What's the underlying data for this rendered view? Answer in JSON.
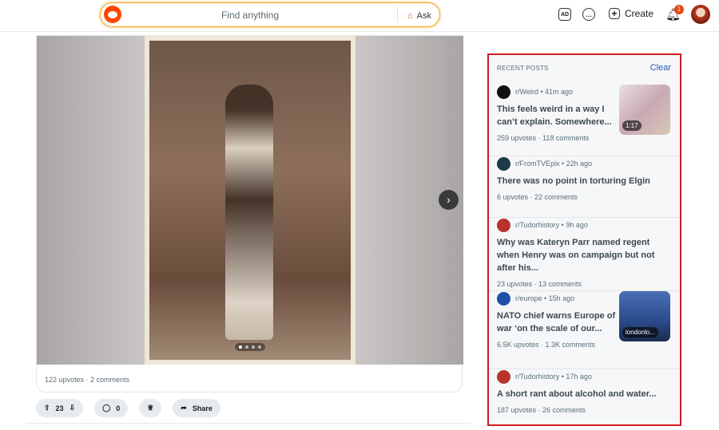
{
  "header": {
    "search_placeholder": "Find anything",
    "ask_label": "Ask",
    "ad_icon_text": "AD",
    "create_label": "Create",
    "notification_count": "1"
  },
  "post": {
    "stats": "122 upvotes · 2 comments",
    "vote_count": "23",
    "comment_count": "0",
    "share_label": "Share",
    "next_icon": "›"
  },
  "sidebar": {
    "heading": "RECENT POSTS",
    "clear_label": "Clear",
    "posts": [
      {
        "meta": "r/Weird • 41m ago",
        "title": "This feels weird in a way I can’t explain. Somewhere...",
        "stats": "259 upvotes · 118 comments",
        "thumb_label": "1:17",
        "icon_color": "#111111"
      },
      {
        "meta": "r/FromTVEpix • 22h ago",
        "title": "There was no point in torturing Elgin",
        "stats": "6 upvotes · 22 comments",
        "icon_color": "#1d3a4a"
      },
      {
        "meta": "r/Tudorhistory • 9h ago",
        "title": "Why was Kateryn Parr named regent when Henry was on campaign but not after his...",
        "stats": "23 upvotes · 13 comments",
        "icon_color": "#b8332a"
      },
      {
        "meta": "r/europe • 15h ago",
        "title": "NATO chief warns Europe of war ‘on the scale of our...",
        "stats": "6.5K upvotes · 1.3K comments",
        "thumb_label": "londonlo...",
        "icon_color": "#1f4fa8"
      },
      {
        "meta": "r/Tudorhistory • 17h ago",
        "title": "A short rant about alcohol and water...",
        "stats": "187 upvotes · 26 comments",
        "icon_color": "#b8332a"
      }
    ]
  }
}
